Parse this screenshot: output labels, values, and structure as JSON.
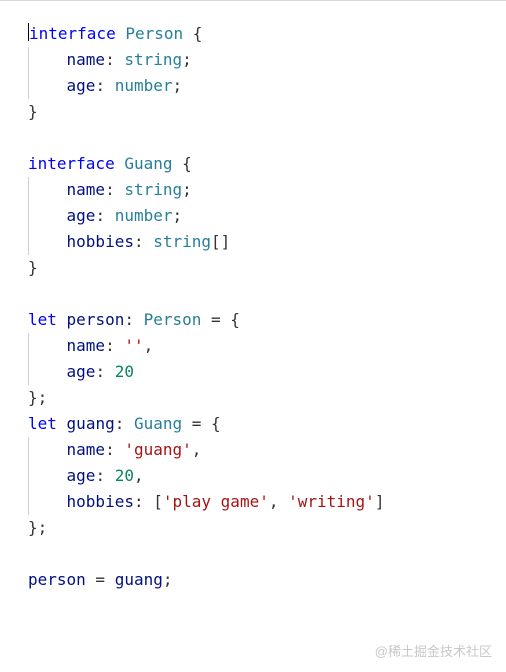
{
  "code": {
    "lines": [
      {
        "indent": 0,
        "guide": false,
        "tokens": [
          {
            "t": "kw",
            "v": "interface"
          },
          {
            "t": "plain",
            "v": " "
          },
          {
            "t": "type",
            "v": "Person"
          },
          {
            "t": "plain",
            "v": " {"
          }
        ],
        "cursor_before": true
      },
      {
        "indent": 1,
        "guide": true,
        "tokens": [
          {
            "t": "prop",
            "v": "name"
          },
          {
            "t": "punct",
            "v": ": "
          },
          {
            "t": "type",
            "v": "string"
          },
          {
            "t": "punct",
            "v": ";"
          }
        ]
      },
      {
        "indent": 1,
        "guide": true,
        "tokens": [
          {
            "t": "prop",
            "v": "age"
          },
          {
            "t": "punct",
            "v": ": "
          },
          {
            "t": "type",
            "v": "number"
          },
          {
            "t": "punct",
            "v": ";"
          }
        ]
      },
      {
        "indent": 0,
        "guide": false,
        "tokens": [
          {
            "t": "plain",
            "v": "}"
          }
        ]
      },
      {
        "indent": 0,
        "guide": false,
        "tokens": []
      },
      {
        "indent": 0,
        "guide": false,
        "tokens": [
          {
            "t": "kw",
            "v": "interface"
          },
          {
            "t": "plain",
            "v": " "
          },
          {
            "t": "type",
            "v": "Guang"
          },
          {
            "t": "plain",
            "v": " {"
          }
        ]
      },
      {
        "indent": 1,
        "guide": true,
        "tokens": [
          {
            "t": "prop",
            "v": "name"
          },
          {
            "t": "punct",
            "v": ": "
          },
          {
            "t": "type",
            "v": "string"
          },
          {
            "t": "punct",
            "v": ";"
          }
        ]
      },
      {
        "indent": 1,
        "guide": true,
        "tokens": [
          {
            "t": "prop",
            "v": "age"
          },
          {
            "t": "punct",
            "v": ": "
          },
          {
            "t": "type",
            "v": "number"
          },
          {
            "t": "punct",
            "v": ";"
          }
        ]
      },
      {
        "indent": 1,
        "guide": true,
        "tokens": [
          {
            "t": "prop",
            "v": "hobbies"
          },
          {
            "t": "punct",
            "v": ": "
          },
          {
            "t": "type",
            "v": "string"
          },
          {
            "t": "punct",
            "v": "[]"
          }
        ]
      },
      {
        "indent": 0,
        "guide": false,
        "tokens": [
          {
            "t": "plain",
            "v": "}"
          }
        ]
      },
      {
        "indent": 0,
        "guide": false,
        "tokens": []
      },
      {
        "indent": 0,
        "guide": false,
        "tokens": [
          {
            "t": "kw",
            "v": "let"
          },
          {
            "t": "plain",
            "v": " "
          },
          {
            "t": "prop",
            "v": "person"
          },
          {
            "t": "punct",
            "v": ": "
          },
          {
            "t": "type",
            "v": "Person"
          },
          {
            "t": "plain",
            "v": " = {"
          }
        ]
      },
      {
        "indent": 1,
        "guide": true,
        "tokens": [
          {
            "t": "prop",
            "v": "name"
          },
          {
            "t": "punct",
            "v": ": "
          },
          {
            "t": "str",
            "v": "''"
          },
          {
            "t": "punct",
            "v": ","
          }
        ]
      },
      {
        "indent": 1,
        "guide": true,
        "tokens": [
          {
            "t": "prop",
            "v": "age"
          },
          {
            "t": "punct",
            "v": ": "
          },
          {
            "t": "num",
            "v": "20"
          }
        ]
      },
      {
        "indent": 0,
        "guide": false,
        "tokens": [
          {
            "t": "plain",
            "v": "};"
          }
        ]
      },
      {
        "indent": 0,
        "guide": false,
        "tokens": [
          {
            "t": "kw",
            "v": "let"
          },
          {
            "t": "plain",
            "v": " "
          },
          {
            "t": "prop",
            "v": "guang"
          },
          {
            "t": "punct",
            "v": ": "
          },
          {
            "t": "type",
            "v": "Guang"
          },
          {
            "t": "plain",
            "v": " = {"
          }
        ]
      },
      {
        "indent": 1,
        "guide": true,
        "tokens": [
          {
            "t": "prop",
            "v": "name"
          },
          {
            "t": "punct",
            "v": ": "
          },
          {
            "t": "str",
            "v": "'guang'"
          },
          {
            "t": "punct",
            "v": ","
          }
        ]
      },
      {
        "indent": 1,
        "guide": true,
        "tokens": [
          {
            "t": "prop",
            "v": "age"
          },
          {
            "t": "punct",
            "v": ": "
          },
          {
            "t": "num",
            "v": "20"
          },
          {
            "t": "punct",
            "v": ","
          }
        ]
      },
      {
        "indent": 1,
        "guide": true,
        "tokens": [
          {
            "t": "prop",
            "v": "hobbies"
          },
          {
            "t": "punct",
            "v": ": ["
          },
          {
            "t": "str",
            "v": "'play game'"
          },
          {
            "t": "punct",
            "v": ", "
          },
          {
            "t": "str",
            "v": "'writing'"
          },
          {
            "t": "punct",
            "v": "]"
          }
        ]
      },
      {
        "indent": 0,
        "guide": false,
        "tokens": [
          {
            "t": "plain",
            "v": "};"
          }
        ]
      },
      {
        "indent": 0,
        "guide": false,
        "tokens": []
      },
      {
        "indent": 0,
        "guide": false,
        "tokens": [
          {
            "t": "prop",
            "v": "person"
          },
          {
            "t": "plain",
            "v": " = "
          },
          {
            "t": "prop",
            "v": "guang"
          },
          {
            "t": "punct",
            "v": ";"
          }
        ]
      }
    ]
  },
  "watermark": "@稀土掘金技术社区"
}
